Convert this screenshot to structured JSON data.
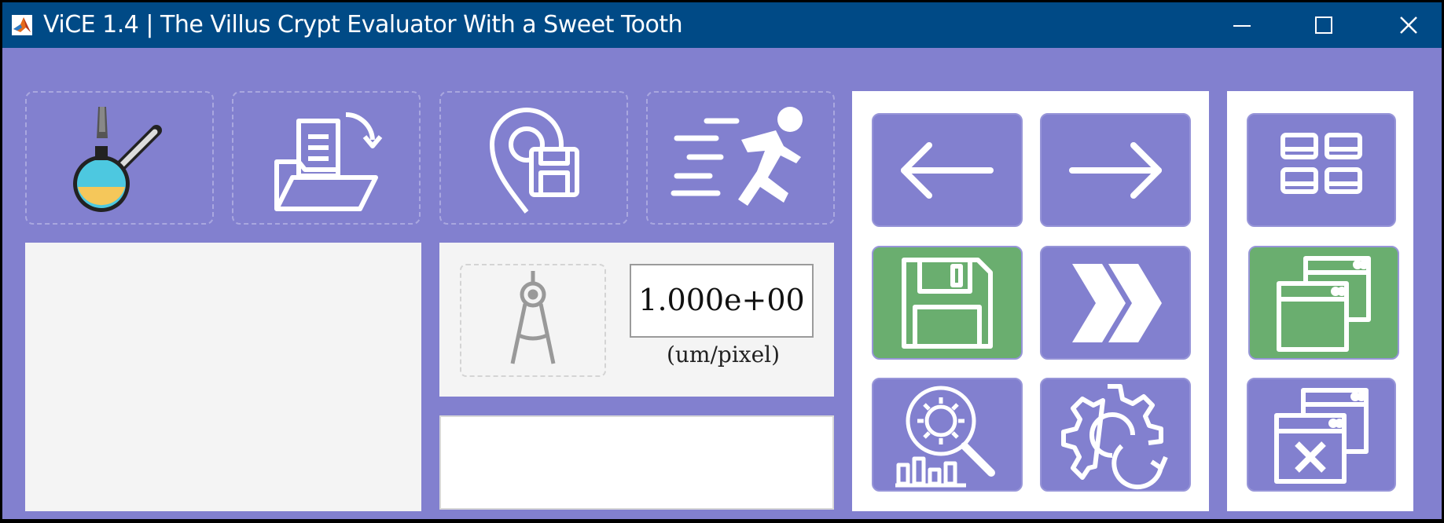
{
  "window": {
    "title": "ViCE 1.4 | The Villus Crypt Evaluator With a Sweet Tooth",
    "minimize_icon": "minimize-icon",
    "maximize_icon": "maximize-icon",
    "close_icon": "close-icon"
  },
  "toolbar": {
    "tools": [
      {
        "name": "flask-brush-icon"
      },
      {
        "name": "load-folder-icon"
      },
      {
        "name": "location-save-icon"
      },
      {
        "name": "run-icon"
      }
    ]
  },
  "scale": {
    "value": "1.000e+00",
    "unit": "(um/pixel)",
    "calibrate_icon": "compass-icon"
  },
  "navigation": {
    "buttons": [
      "arrow-left-icon",
      "arrow-right-icon",
      "floppy-save-icon",
      "fast-forward-icon",
      "analytics-search-icon",
      "settings-refresh-icon"
    ]
  },
  "views": {
    "buttons": [
      "grid-view-icon",
      "windows-stack-icon",
      "close-windows-icon"
    ]
  },
  "colors": {
    "background": "#8280cf",
    "titlebar": "#004a86",
    "save_green": "#6aae6f",
    "panel": "#f4f4f4"
  }
}
